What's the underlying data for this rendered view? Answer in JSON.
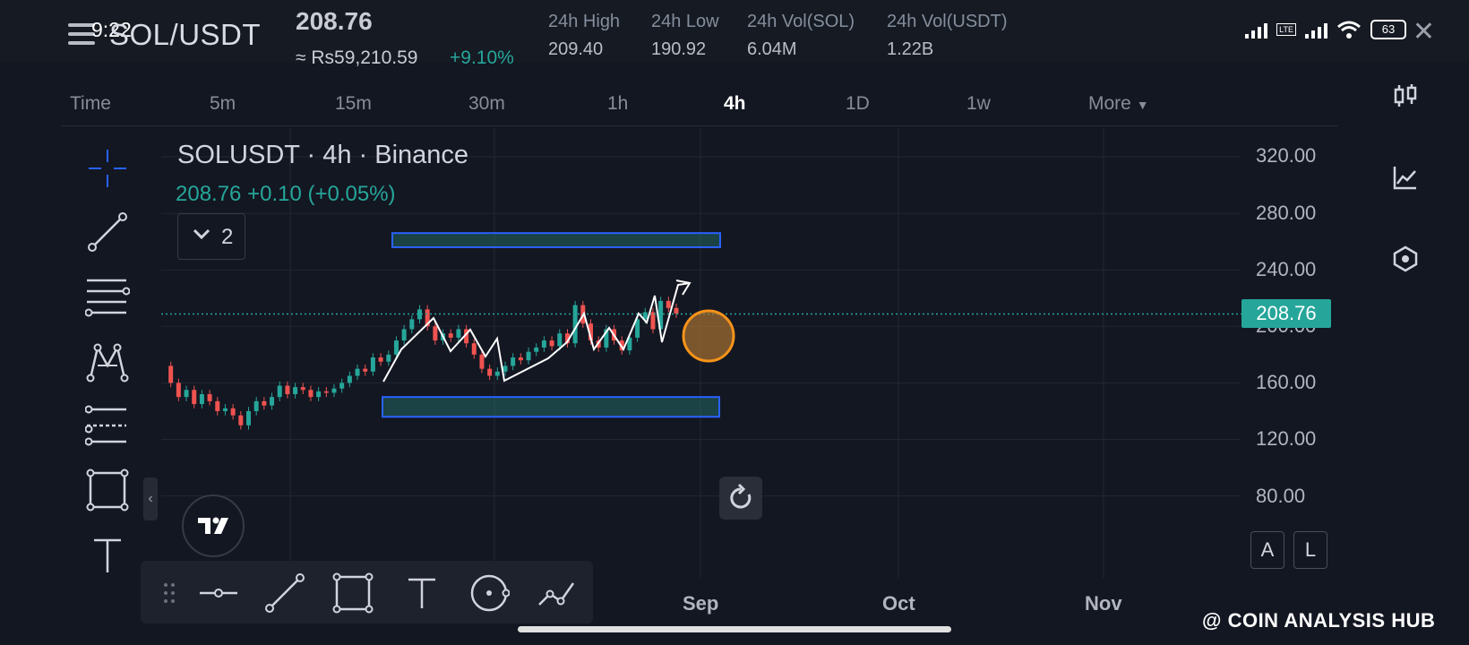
{
  "status_bar": {
    "time": "9:22",
    "battery": "63",
    "network": "LTE"
  },
  "header": {
    "pair": "SOL/USDT",
    "price": "208.76",
    "local_price": "≈ Rs59,210.59",
    "change": "+9.10%",
    "stats": [
      {
        "label": "24h High",
        "value": "209.40"
      },
      {
        "label": "24h Low",
        "value": "190.92"
      },
      {
        "label": "24h Vol(SOL)",
        "value": "6.04M"
      },
      {
        "label": "24h Vol(USDT)",
        "value": "1.22B"
      }
    ]
  },
  "timeframes": [
    "Time",
    "5m",
    "15m",
    "30m",
    "1h",
    "4h",
    "1D",
    "1w",
    "More"
  ],
  "active_timeframe": "4h",
  "chart_legend": {
    "title": "SOLUSDT · 4h · Binance",
    "price_line": "208.76  +0.10 (+0.05%)",
    "indicator_count": "2"
  },
  "y_axis": [
    "320.00",
    "280.00",
    "240.00",
    "200.00",
    "160.00",
    "120.00",
    "80.00"
  ],
  "x_axis": [
    "Sep",
    "Oct",
    "Nov"
  ],
  "current_price_tag": "208.76",
  "buttons": {
    "auto": "A",
    "log": "L"
  },
  "watermark": "@ COIN ANALYSIS HUB",
  "colors": {
    "up": "#26a69a",
    "down": "#ef5350",
    "accent": "#2962ff",
    "circle": "#f7931a"
  },
  "chart_data": {
    "type": "candlestick",
    "title": "SOLUSDT · 4h · Binance",
    "ylim": [
      55,
      340
    ],
    "y_ticks": [
      80,
      120,
      160,
      200,
      240,
      280,
      320
    ],
    "x_ticks": [
      "Sep",
      "Oct",
      "Nov"
    ],
    "last_price": 208.76,
    "close_series": [
      172,
      160,
      150,
      155,
      145,
      152,
      147,
      140,
      142,
      137,
      130,
      140,
      147,
      144,
      150,
      158,
      152,
      157,
      155,
      150,
      154,
      153,
      156,
      160,
      165,
      170,
      168,
      178,
      175,
      180,
      190,
      198,
      205,
      212,
      200,
      190,
      195,
      192,
      198,
      188,
      180,
      170,
      165,
      168,
      172,
      178,
      176,
      182,
      185,
      190,
      186,
      195,
      188,
      215,
      202,
      190,
      185,
      198,
      190,
      183,
      192,
      205,
      210,
      198,
      218,
      213,
      209
    ],
    "zones": [
      {
        "name": "resistance",
        "low": 256,
        "high": 266
      },
      {
        "name": "support",
        "low": 136,
        "high": 150
      }
    ]
  }
}
